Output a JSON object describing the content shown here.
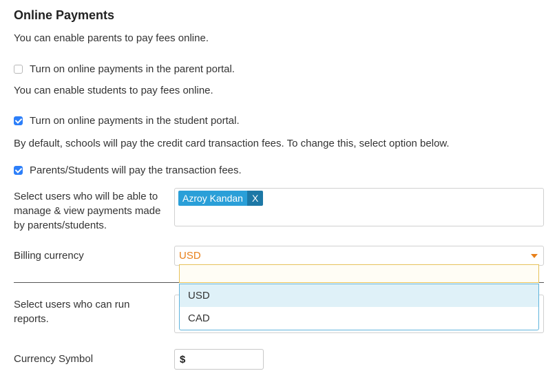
{
  "section": {
    "title": "Online Payments"
  },
  "parents": {
    "intro": "You can enable parents to pay fees online.",
    "checkbox_label": "Turn on online payments in the parent portal.",
    "checked": false
  },
  "students": {
    "intro": "You can enable students to pay fees online.",
    "checkbox_label": "Turn on online payments in the student portal.",
    "checked": true
  },
  "fees": {
    "intro": "By default, schools will pay the credit card transaction fees. To change this, select option below.",
    "checkbox_label": "Parents/Students will pay the transaction fees.",
    "checked": true
  },
  "payment_managers": {
    "label": "Select users who will be able to manage & view payments made by parents/students.",
    "tags": [
      {
        "name": "Azroy Kandan",
        "remove_label": "X"
      }
    ]
  },
  "billing_currency": {
    "label": "Billing currency",
    "selected": "USD",
    "search_value": "",
    "options": [
      "USD",
      "CAD"
    ],
    "highlighted": "USD"
  },
  "report_users": {
    "label": "Select users who can run reports."
  },
  "currency_symbol": {
    "label": "Currency Symbol",
    "value": "$"
  },
  "colors": {
    "accent_orange": "#e8801a",
    "tag_blue": "#2a9fd8",
    "tag_remove_blue": "#1d78a6",
    "checkbox_blue": "#2d7ff9",
    "highlight_row": "#dff1f8"
  }
}
